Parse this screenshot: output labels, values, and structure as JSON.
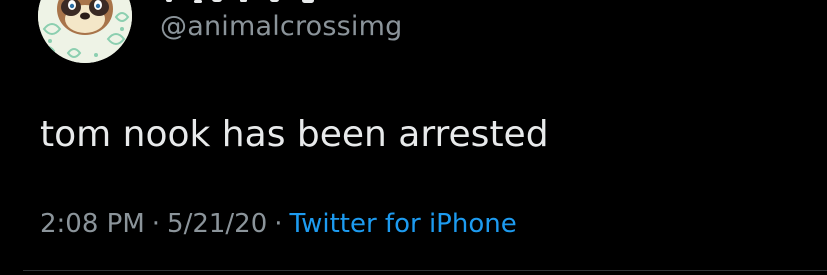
{
  "tweet": {
    "handle": "@animalcrossimg",
    "text": "tom nook has been arrested",
    "time": "2:08 PM",
    "date": "5/21/20",
    "separator": "·",
    "source": "Twitter for iPhone"
  },
  "avatar": {
    "icon": "tom-nook-avatar",
    "background_color": "#eef3e6",
    "leaf_color": "#8ccfb0"
  },
  "colors": {
    "background": "#000000",
    "primary_text": "#e8eaeb",
    "secondary_text": "#8b949a",
    "link": "#1d9bf0",
    "divider": "#2f3336"
  }
}
